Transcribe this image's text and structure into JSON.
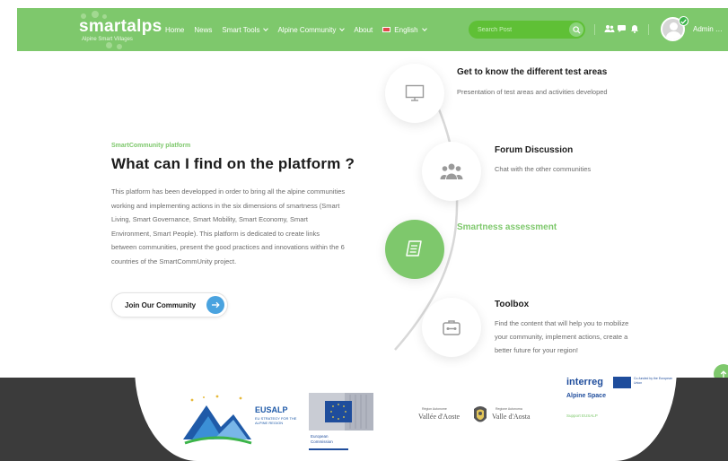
{
  "header": {
    "logo_title": "smartalps",
    "logo_tag": "Alpine Smart Villages",
    "nav": [
      {
        "label": "Home"
      },
      {
        "label": "News"
      },
      {
        "label": "Smart Tools",
        "dropdown": true
      },
      {
        "label": "Alpine Community",
        "dropdown": true
      },
      {
        "label": "About"
      },
      {
        "label": "English",
        "dropdown": true,
        "flag": true
      }
    ],
    "search_placeholder": "Search Post",
    "user_name": "Admin",
    "icons": [
      "search-icon",
      "users-icon",
      "chat-icon",
      "bell-icon",
      "avatar",
      "check-badge-icon",
      "more-icon"
    ],
    "more_label": "…"
  },
  "intro": {
    "eyebrow": "SmartCommunity platform",
    "title": "What can I find on the platform ?",
    "description": "This platform has been developped in order to bring all the alpine communities working and implementing actions in the six dimensions of smartness (Smart Living, Smart Governance, Smart Mobility, Smart Economy, Smart Environment, Smart People). This platform is dedicated to create links between communities, present the good practices and innovations within the 6 countries of the SmartCommUnity project.",
    "join_label": "Join Our Community"
  },
  "features": [
    {
      "title": "Get to know the different test areas",
      "desc": "Presentation of test areas and activities developed",
      "icon": "monitor-icon",
      "active": false
    },
    {
      "title": "Forum Discussion",
      "desc": "Chat with the other communities",
      "icon": "users-icon",
      "active": false
    },
    {
      "title": "Smartness assessment",
      "desc": "",
      "icon": "document-icon",
      "active": true
    },
    {
      "title": "Toolbox",
      "desc": "Find the content that will help you to mobilize your community, implement actions, create a better future for your region!",
      "icon": "toolbox-icon",
      "active": false
    }
  ],
  "footer_logos": {
    "eusalp_title": "EUSALP",
    "eusalp_sub": "EU STRATEGY FOR THE ALPINE REGION",
    "eu_label": "European Commission",
    "vda_small": "Région Autonome",
    "vda_name": "Vallée d'Aoste",
    "vda_small2": "Regione Autonoma",
    "vda_name2": "Valle d'Aosta",
    "interreg": "interreg",
    "interreg_sub": "Alpine Space",
    "cofunded": "Co-funded by the European Union",
    "support": "Support EUSALP"
  },
  "colors": {
    "brand_green": "#7ec86c",
    "search_green": "#5fc036",
    "join_arrow_blue": "#4aa3df",
    "footer_dark": "#3b3b3b",
    "interreg_blue": "#1f4d9c"
  }
}
